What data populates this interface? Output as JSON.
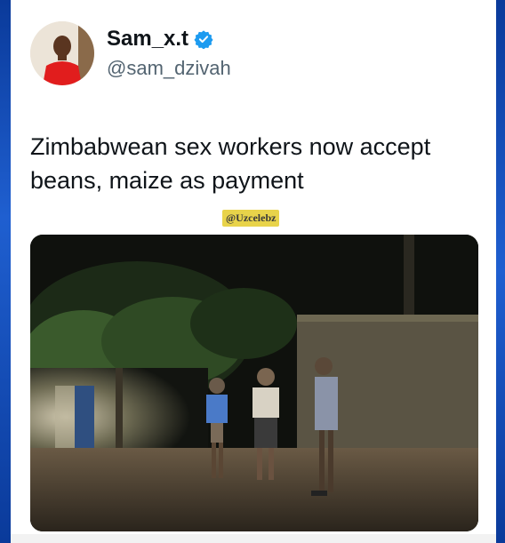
{
  "post": {
    "author_name": "Sam_x.t",
    "author_handle": "@sam_dzivah",
    "text": "Zimbabwean sex workers now accept beans, maize as payment",
    "watermark": "@Uzcelebz",
    "verified_icon": "verified-badge-icon",
    "accent_color": "#1d9bf0"
  }
}
